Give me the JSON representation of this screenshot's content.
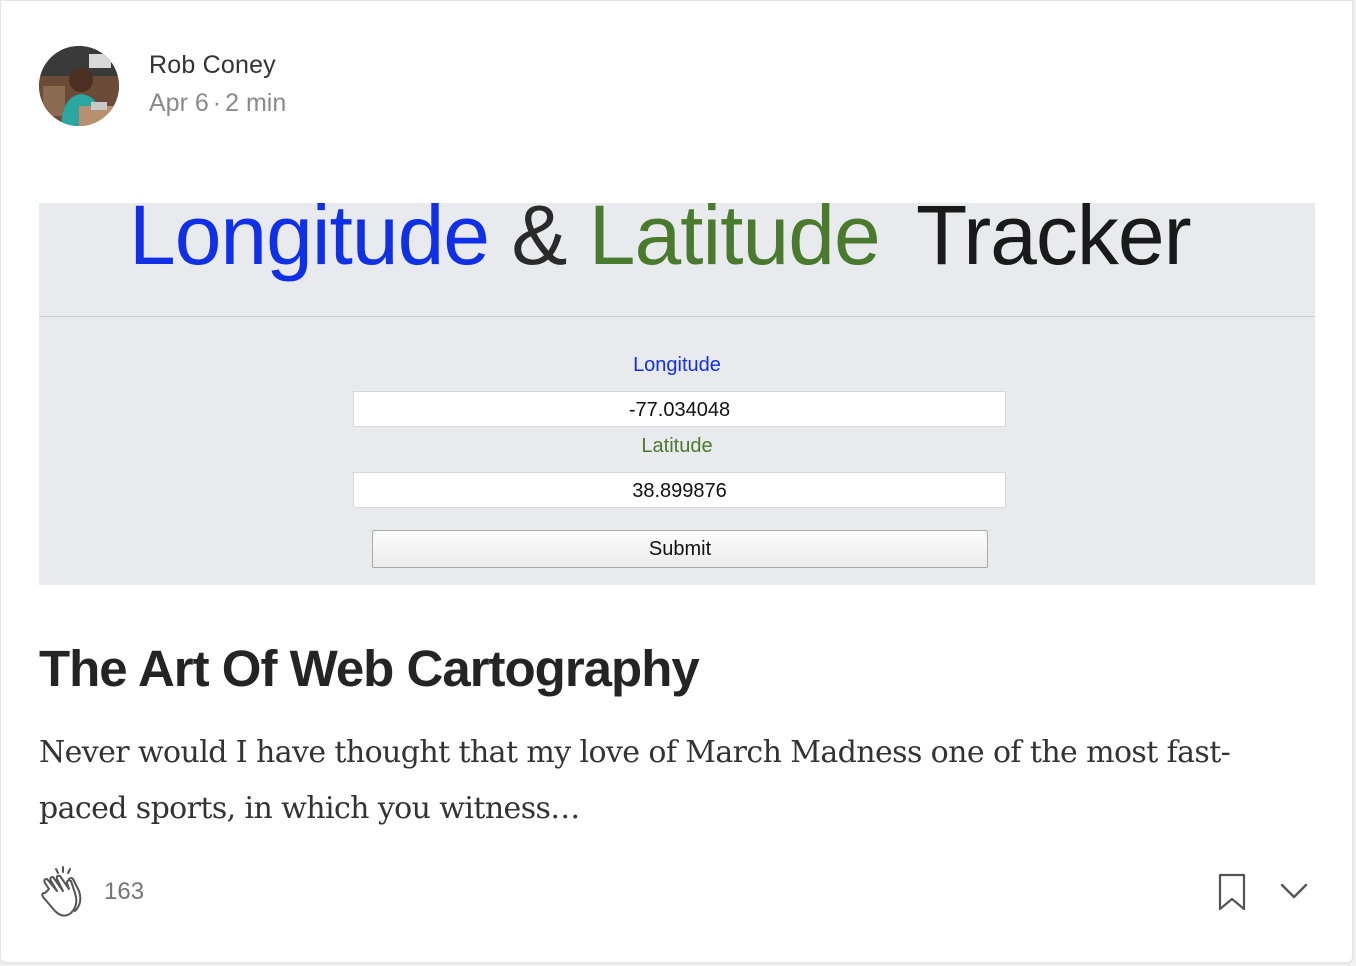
{
  "author": {
    "name": "Rob Coney",
    "date": "Apr 6",
    "separator": "·",
    "read_time": "2 min"
  },
  "hero": {
    "title_longitude": "Longitude",
    "title_amp": "&",
    "title_latitude": "Latitude",
    "title_tracker": "Tracker",
    "longitude_label": "Longitude",
    "longitude_value": "-77.034048",
    "latitude_label": "Latitude",
    "latitude_value": "38.899876",
    "submit_label": "Submit"
  },
  "post": {
    "title": "The Art Of Web Cartography",
    "excerpt": "Never would I have thought that my love of March Madness one of the most fast-paced sports, in which you witness…"
  },
  "actions": {
    "clap_count": "163",
    "clap_icon": "clap-icon",
    "bookmark_icon": "bookmark-icon",
    "more_icon": "chevron-down-icon"
  },
  "colors": {
    "longitude": "#1030e6",
    "latitude": "#4a7a2e",
    "hero_bg": "#e9eaee"
  }
}
